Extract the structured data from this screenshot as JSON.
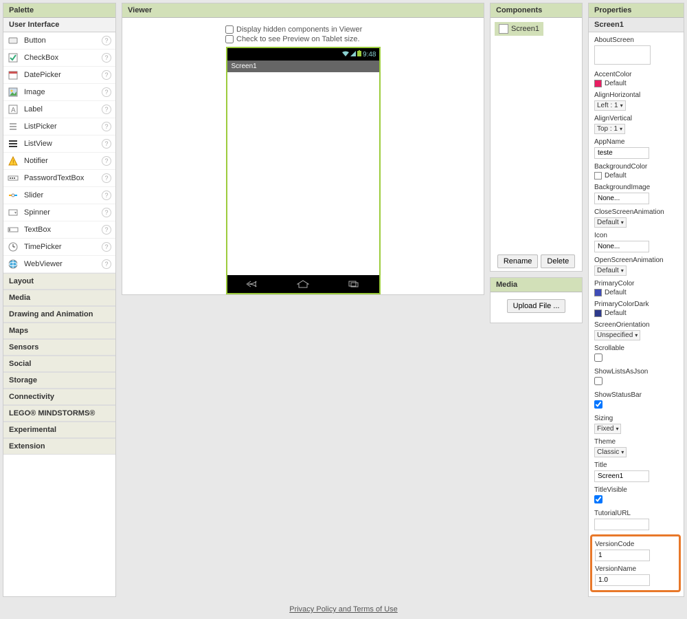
{
  "palette": {
    "title": "Palette",
    "activeCategory": "User Interface",
    "items": [
      {
        "label": "Button",
        "icon": "button"
      },
      {
        "label": "CheckBox",
        "icon": "checkbox"
      },
      {
        "label": "DatePicker",
        "icon": "datepicker"
      },
      {
        "label": "Image",
        "icon": "image"
      },
      {
        "label": "Label",
        "icon": "label"
      },
      {
        "label": "ListPicker",
        "icon": "listpicker"
      },
      {
        "label": "ListView",
        "icon": "listview"
      },
      {
        "label": "Notifier",
        "icon": "notifier"
      },
      {
        "label": "PasswordTextBox",
        "icon": "password"
      },
      {
        "label": "Slider",
        "icon": "slider"
      },
      {
        "label": "Spinner",
        "icon": "spinner"
      },
      {
        "label": "TextBox",
        "icon": "textbox"
      },
      {
        "label": "TimePicker",
        "icon": "timepicker"
      },
      {
        "label": "WebViewer",
        "icon": "webviewer"
      }
    ],
    "categories": [
      "Layout",
      "Media",
      "Drawing and Animation",
      "Maps",
      "Sensors",
      "Social",
      "Storage",
      "Connectivity",
      "LEGO® MINDSTORMS®",
      "Experimental",
      "Extension"
    ]
  },
  "viewer": {
    "title": "Viewer",
    "displayHidden": "Display hidden components in Viewer",
    "tabletPreview": "Check to see Preview on Tablet size.",
    "screenTitle": "Screen1",
    "time": "9:48"
  },
  "components": {
    "title": "Components",
    "root": "Screen1",
    "renameBtn": "Rename",
    "deleteBtn": "Delete"
  },
  "media": {
    "title": "Media",
    "uploadBtn": "Upload File ..."
  },
  "properties": {
    "title": "Properties",
    "screenName": "Screen1",
    "labels": {
      "aboutScreen": "AboutScreen",
      "accentColor": "AccentColor",
      "alignHorizontal": "AlignHorizontal",
      "alignVertical": "AlignVertical",
      "appName": "AppName",
      "backgroundColor": "BackgroundColor",
      "backgroundImage": "BackgroundImage",
      "closeScreenAnimation": "CloseScreenAnimation",
      "icon": "Icon",
      "openScreenAnimation": "OpenScreenAnimation",
      "primaryColor": "PrimaryColor",
      "primaryColorDark": "PrimaryColorDark",
      "screenOrientation": "ScreenOrientation",
      "scrollable": "Scrollable",
      "showListsAsJson": "ShowListsAsJson",
      "showStatusBar": "ShowStatusBar",
      "sizing": "Sizing",
      "theme": "Theme",
      "titleProp": "Title",
      "titleVisible": "TitleVisible",
      "tutorialURL": "TutorialURL",
      "versionCode": "VersionCode",
      "versionName": "VersionName"
    },
    "values": {
      "accentColor": "Default",
      "accentColorHex": "#e91e63",
      "alignHorizontal": "Left : 1",
      "alignVertical": "Top : 1",
      "appName": "teste",
      "backgroundColor": "Default",
      "backgroundColorHex": "#ffffff",
      "backgroundImage": "None...",
      "closeScreenAnimation": "Default",
      "icon": "None...",
      "openScreenAnimation": "Default",
      "primaryColor": "Default",
      "primaryColorHex": "#3f4db8",
      "primaryColorDark": "Default",
      "primaryColorDarkHex": "#2e3a8c",
      "screenOrientation": "Unspecified",
      "sizing": "Fixed",
      "theme": "Classic",
      "titleProp": "Screen1",
      "versionCode": "1",
      "versionName": "1.0"
    }
  },
  "footer": {
    "link": "Privacy Policy and Terms of Use"
  }
}
